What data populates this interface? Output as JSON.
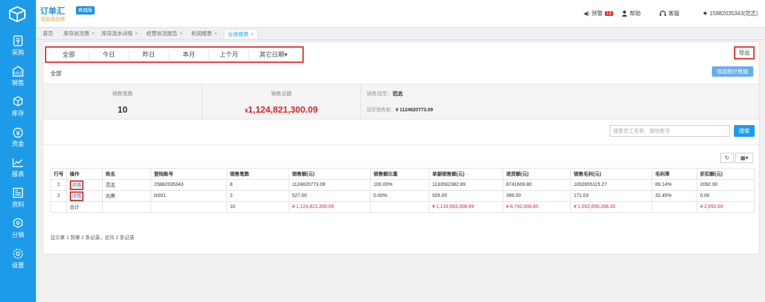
{
  "brand": {
    "name": "订单汇",
    "tag": "商城版",
    "sub": "管家婆品牌"
  },
  "topbar": {
    "alerts_label": "预警",
    "alerts_count": "13",
    "help_label": "帮助",
    "service_label": "客服",
    "account": "15882035343(范志)"
  },
  "sidebar": [
    {
      "label": "采购",
      "icon": "purchase-icon"
    },
    {
      "label": "销售",
      "icon": "sale-icon"
    },
    {
      "label": "库存",
      "icon": "stock-icon"
    },
    {
      "label": "资金",
      "icon": "money-icon"
    },
    {
      "label": "报表",
      "icon": "report-icon"
    },
    {
      "label": "资料",
      "icon": "data-icon"
    },
    {
      "label": "分销",
      "icon": "distribution-icon"
    },
    {
      "label": "设置",
      "icon": "settings-icon"
    }
  ],
  "tabs": [
    {
      "label": "首页"
    },
    {
      "label": "库存状况表"
    },
    {
      "label": "库存流水详情"
    },
    {
      "label": "经营状况报告"
    },
    {
      "label": "利润报表"
    },
    {
      "label": "业绩报表"
    }
  ],
  "date_filters": [
    "全部",
    "今日",
    "昨日",
    "本月",
    "上个月",
    "其它日期▾"
  ],
  "export_label": "导出",
  "section_title": "全部",
  "collapse_label": "收起统计数据",
  "stats": {
    "count_label": "销售笔数",
    "count_value": "10",
    "total_label": "销售总额",
    "total_currency": "¥",
    "total_value": "1,124,821,300.09",
    "champ_label": "销售冠军：",
    "champ_name": "范志",
    "champ_amount_label": "冠军销售额：",
    "champ_amount": "¥ 1124820773.09"
  },
  "search": {
    "placeholder": "搜索员工名称、登陆账号",
    "button": "搜索"
  },
  "table": {
    "headers": [
      "行号",
      "操作",
      "姓名",
      "登陆账号",
      "销售笔数",
      "销售额(元)",
      "销售额比重",
      "单据销售额(元)",
      "退货额(元)",
      "销售毛利(元)",
      "毛利率",
      "折扣额(元)"
    ],
    "rows": [
      {
        "no": "1",
        "op": "详情",
        "name": "范志",
        "account": "15882035343",
        "count": "8",
        "sales": "1124820773.09",
        "ratio": "100.00%",
        "bill": "1133562382.89",
        "refund": "8741609.80",
        "profit": "1002655115.27",
        "margin": "89.14%",
        "discount": "2092.00"
      },
      {
        "no": "2",
        "op": "详情",
        "name": "刘黑",
        "account": "fz001",
        "count": "2",
        "sales": "527.00",
        "ratio": "0.00%",
        "bill": "926.00",
        "refund": "399.00",
        "profit": "171.03",
        "margin": "32.45%",
        "discount": "0.00"
      }
    ],
    "total": {
      "label": "合计",
      "count": "10",
      "sales": "¥ 1,124,821,300.09",
      "bill": "¥ 1,133,563,308.89",
      "refund": "¥ 8,742,008.80",
      "profit": "¥ 1,002,655,286.30",
      "discount": "¥ 2,092.00"
    }
  },
  "footer_info": "显示第 1 到第 2 条记录，总共 2 条记录",
  "colors": {
    "accent": "#1e9be8",
    "highlight": "#e53935",
    "money": "#d9232d"
  }
}
